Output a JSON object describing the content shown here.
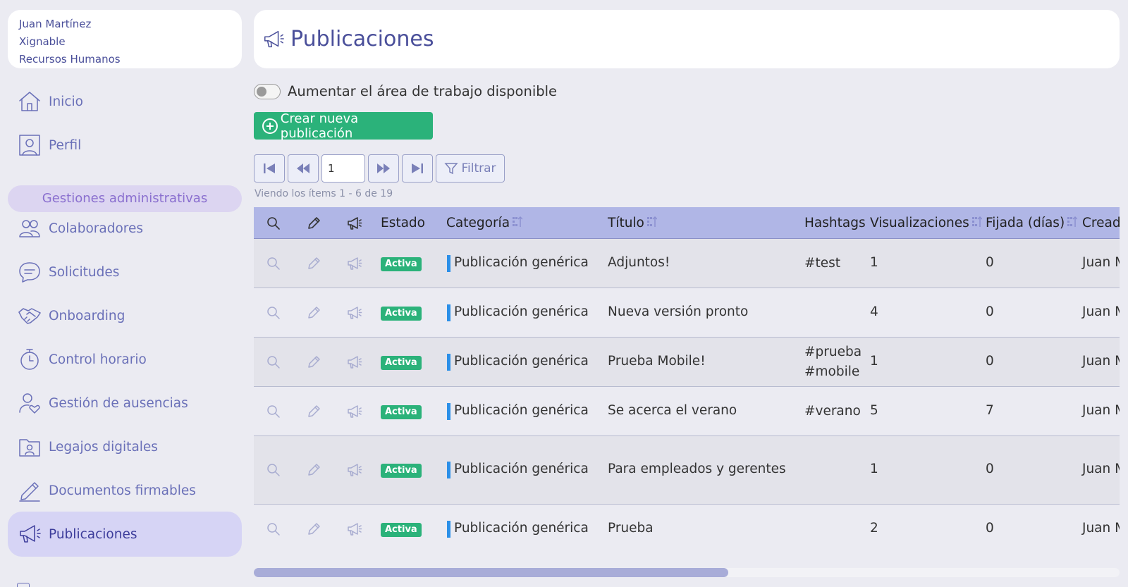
{
  "user": {
    "name": "Juan Martínez",
    "company": "Xignable",
    "department": "Recursos Humanos"
  },
  "sidebar": {
    "items_top": [
      {
        "label": "Inicio",
        "icon": "home-icon"
      },
      {
        "label": "Perfil",
        "icon": "profile-icon"
      }
    ],
    "section_label": "Gestiones administrativas",
    "items": [
      {
        "label": "Colaboradores",
        "icon": "users-icon"
      },
      {
        "label": "Solicitudes",
        "icon": "chat-icon"
      },
      {
        "label": "Onboarding",
        "icon": "handshake-icon"
      },
      {
        "label": "Control horario",
        "icon": "stopwatch-icon"
      },
      {
        "label": "Gestión de ausencias",
        "icon": "user-heart-icon"
      },
      {
        "label": "Legajos digitales",
        "icon": "folder-user-icon"
      },
      {
        "label": "Documentos firmables",
        "icon": "pen-sign-icon"
      },
      {
        "label": "Publicaciones",
        "icon": "megaphone-icon",
        "active": true
      }
    ]
  },
  "header": {
    "title": "Publicaciones",
    "icon": "megaphone-icon"
  },
  "toolbar": {
    "toggle_label": "Aumentar el área de trabajo disponible",
    "toggle_on": false,
    "create_label": "Crear nueva publicación",
    "page_value": "1",
    "filter_label": "Filtrar",
    "viewing_text": "Viendo los ítems 1 - 6  de  19"
  },
  "table": {
    "columns": {
      "estado": "Estado",
      "categoria": "Categoría",
      "titulo": "Título",
      "hashtags": "Hashtags",
      "visualizaciones": "Visualizaciones",
      "fijada": "Fijada (días)",
      "creado": "Cread"
    },
    "status_label": "Activa",
    "rows": [
      {
        "categoria": "Publicación genérica",
        "titulo": "Adjuntos!",
        "hashtags": [
          "#test"
        ],
        "visualizaciones": "1",
        "fijada": "0",
        "creado": "Juan M"
      },
      {
        "categoria": "Publicación genérica",
        "titulo": "Nueva versión pronto",
        "hashtags": [],
        "visualizaciones": "4",
        "fijada": "0",
        "creado": "Juan M"
      },
      {
        "categoria": "Publicación genérica",
        "titulo": "Prueba Mobile!",
        "hashtags": [
          "#prueba",
          "#mobile"
        ],
        "visualizaciones": "1",
        "fijada": "0",
        "creado": "Juan M"
      },
      {
        "categoria": "Publicación genérica",
        "titulo": "Se acerca el verano",
        "hashtags": [
          "#verano"
        ],
        "visualizaciones": "5",
        "fijada": "7",
        "creado": "Juan M"
      },
      {
        "categoria": "Publicación genérica",
        "titulo": "Para empleados y gerentes",
        "hashtags": [],
        "visualizaciones": "1",
        "fijada": "0",
        "creado": "Juan M"
      },
      {
        "categoria": "Publicación genérica",
        "titulo": "Prueba",
        "hashtags": [],
        "visualizaciones": "2",
        "fijada": "0",
        "creado": "Juan M"
      }
    ]
  },
  "colors": {
    "accent": "#4a4f9a",
    "success": "#2bb27a",
    "table_header": "#b0b6e6",
    "category_bar": "#2b8fe8"
  }
}
